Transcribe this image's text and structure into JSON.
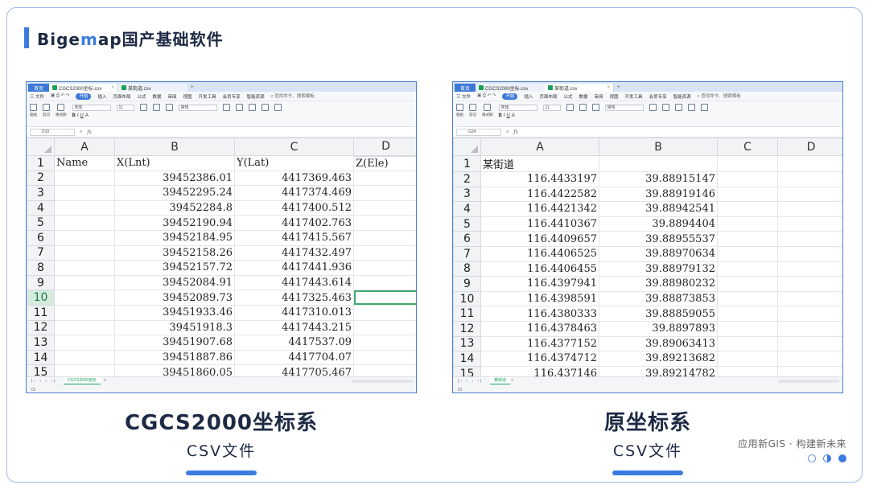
{
  "brand": {
    "name_prefix": "Bige",
    "name_accent": "m",
    "name_suffix": "ap国产基础软件"
  },
  "left_window": {
    "tabs": {
      "home": "首页",
      "doc": "CGCS2000坐标.csv",
      "doc2": "某街道.csv"
    },
    "menu": [
      "三 文件",
      "开始",
      "插入",
      "页面布局",
      "公式",
      "数据",
      "审阅",
      "视图",
      "开发工具",
      "会员专享",
      "智能资源",
      "查找命令、搜索模板"
    ],
    "ribbon": {
      "font_name": "宋体",
      "font_size": "11",
      "number_format": "常规",
      "paste": "粘贴",
      "cut": "剪切",
      "format_painter": "格式刷"
    },
    "name_box": "D10",
    "columns": [
      "A",
      "B",
      "C",
      "D"
    ],
    "rows": [
      {
        "n": "1",
        "a": "Name",
        "b": "X(Lnt)",
        "c": "Y(Lat)",
        "d": "Z(Ele)"
      },
      {
        "n": "2",
        "a": "",
        "b": "39452386.01",
        "c": "4417369.463",
        "d": ""
      },
      {
        "n": "3",
        "a": "",
        "b": "39452295.24",
        "c": "4417374.469",
        "d": ""
      },
      {
        "n": "4",
        "a": "",
        "b": "39452284.8",
        "c": "4417400.512",
        "d": ""
      },
      {
        "n": "5",
        "a": "",
        "b": "39452190.94",
        "c": "4417402.763",
        "d": ""
      },
      {
        "n": "6",
        "a": "",
        "b": "39452184.95",
        "c": "4417415.567",
        "d": ""
      },
      {
        "n": "7",
        "a": "",
        "b": "39452158.26",
        "c": "4417432.497",
        "d": ""
      },
      {
        "n": "8",
        "a": "",
        "b": "39452157.72",
        "c": "4417441.936",
        "d": ""
      },
      {
        "n": "9",
        "a": "",
        "b": "39452084.91",
        "c": "4417443.614",
        "d": ""
      },
      {
        "n": "10",
        "a": "",
        "b": "39452089.73",
        "c": "4417325.463",
        "d": ""
      },
      {
        "n": "11",
        "a": "",
        "b": "39451933.46",
        "c": "4417310.013",
        "d": ""
      },
      {
        "n": "12",
        "a": "",
        "b": "39451918.3",
        "c": "4417443.215",
        "d": ""
      },
      {
        "n": "13",
        "a": "",
        "b": "39451907.68",
        "c": "4417537.09",
        "d": ""
      },
      {
        "n": "14",
        "a": "",
        "b": "39451887.86",
        "c": "4417704.07",
        "d": ""
      },
      {
        "n": "15",
        "a": "",
        "b": "39451860.05",
        "c": "4417705.467",
        "d": ""
      }
    ],
    "sheet_tab": "CGCS2000坐标",
    "selected_cell": "D10"
  },
  "right_window": {
    "tabs": {
      "home": "首页",
      "doc": "CGCS2000坐标.csv",
      "doc2": "某街道.csv"
    },
    "menu": [
      "三 文件",
      "开始",
      "插入",
      "页面布局",
      "公式",
      "数据",
      "审阅",
      "视图",
      "开发工具",
      "会员专享",
      "智能资源",
      "查找命令、搜索模板"
    ],
    "ribbon": {
      "font_name": "宋体",
      "font_size": "11",
      "number_format": "常规",
      "paste": "粘贴",
      "cut": "剪切",
      "format_painter": "格式刷"
    },
    "name_box": "G24",
    "columns": [
      "A",
      "B",
      "C",
      "D"
    ],
    "rows": [
      {
        "n": "1",
        "a": "某街道",
        "b": "",
        "c": "",
        "d": ""
      },
      {
        "n": "2",
        "a": "116.4433197",
        "b": "39.88915147",
        "c": "",
        "d": ""
      },
      {
        "n": "3",
        "a": "116.4422582",
        "b": "39.88919146",
        "c": "",
        "d": ""
      },
      {
        "n": "4",
        "a": "116.4421342",
        "b": "39.88942541",
        "c": "",
        "d": ""
      },
      {
        "n": "5",
        "a": "116.4410367",
        "b": "39.8894404",
        "c": "",
        "d": ""
      },
      {
        "n": "6",
        "a": "116.4409657",
        "b": "39.88955537",
        "c": "",
        "d": ""
      },
      {
        "n": "7",
        "a": "116.4406525",
        "b": "39.88970634",
        "c": "",
        "d": ""
      },
      {
        "n": "8",
        "a": "116.4406455",
        "b": "39.88979132",
        "c": "",
        "d": ""
      },
      {
        "n": "9",
        "a": "116.4397941",
        "b": "39.88980232",
        "c": "",
        "d": ""
      },
      {
        "n": "10",
        "a": "116.4398591",
        "b": "39.88873853",
        "c": "",
        "d": ""
      },
      {
        "n": "11",
        "a": "116.4380333",
        "b": "39.88859055",
        "c": "",
        "d": ""
      },
      {
        "n": "12",
        "a": "116.4378463",
        "b": "39.8897893",
        "c": "",
        "d": ""
      },
      {
        "n": "13",
        "a": "116.4377152",
        "b": "39.89063413",
        "c": "",
        "d": ""
      },
      {
        "n": "14",
        "a": "116.4374712",
        "b": "39.89213682",
        "c": "",
        "d": ""
      },
      {
        "n": "15",
        "a": "116.437146",
        "b": "39.89214782",
        "c": "",
        "d": ""
      }
    ],
    "sheet_tab": "某街道"
  },
  "captions": {
    "left_title": "CGCS2000坐标系",
    "left_sub": "CSV文件",
    "right_title": "原坐标系",
    "right_sub": "CSV文件"
  },
  "slogan": "应用新GIS · 构建新未来",
  "colors": {
    "accent": "#3b7be0",
    "excel_green": "#19a05b",
    "text_dark": "#1d2a44"
  }
}
